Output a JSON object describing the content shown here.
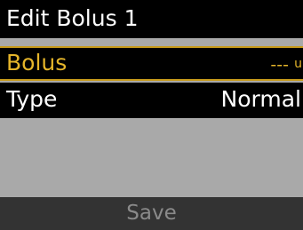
{
  "header": {
    "title": "Edit Bolus 1"
  },
  "fields": [
    {
      "label": "Bolus",
      "value": "---",
      "unit": "u"
    },
    {
      "label": "Type",
      "value": "Normal"
    }
  ],
  "footer": {
    "save_label": "Save"
  },
  "colors": {
    "selected_accent": "#e5b52a",
    "selected_border": "#c79a1a",
    "background": "#a9a9a9",
    "header_bg": "#000000",
    "footer_bg": "#333333",
    "disabled_text": "#8a8a8a"
  }
}
